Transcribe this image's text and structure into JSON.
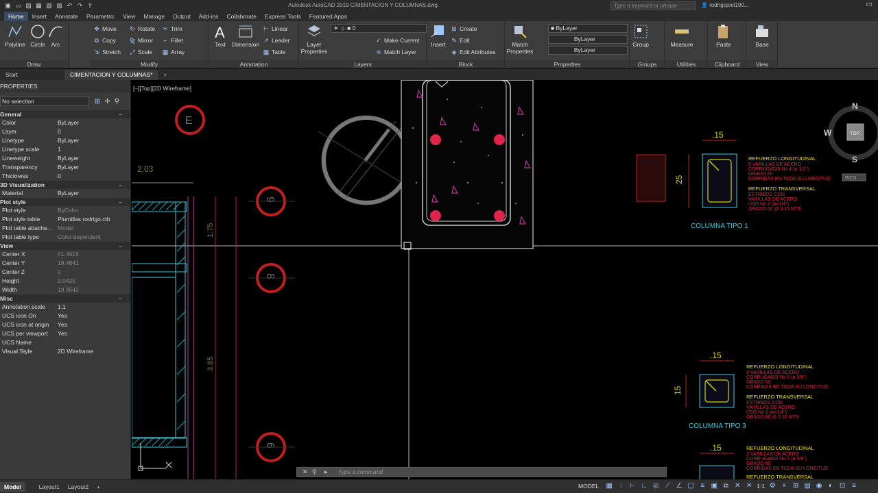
{
  "app": {
    "title": "Autodesk AutoCAD 2019    CIMENTACION Y COLUMNAS.dwg",
    "search_placeholder": "Type a keyword or phrase",
    "user": "rodrigojoel190..."
  },
  "ribbon_tabs": [
    "Home",
    "Insert",
    "Annotate",
    "Parametric",
    "View",
    "Manage",
    "Output",
    "Add-ins",
    "Collaborate",
    "Express Tools",
    "Featured Apps"
  ],
  "ribbon": {
    "draw": {
      "title": "Draw",
      "polyline": "Polyline",
      "circle": "Circle",
      "arc": "Arc"
    },
    "modify": {
      "title": "Modify",
      "move": "Move",
      "rotate": "Rotate",
      "trim": "Trim",
      "copy": "Copy",
      "mirror": "Mirror",
      "fillet": "Fillet",
      "stretch": "Stretch",
      "scale": "Scale",
      "array": "Array"
    },
    "annotation": {
      "title": "Annotation",
      "text": "Text",
      "dimension": "Dimension",
      "linear": "Linear",
      "leader": "Leader",
      "table": "Table"
    },
    "layers": {
      "title": "Layers",
      "layer_properties": "Layer Properties",
      "layer_value": "0",
      "make_current": "Make Current",
      "match_layer": "Match Layer"
    },
    "block": {
      "title": "Block",
      "insert": "Insert",
      "create": "Create",
      "edit": "Edit",
      "edit_attributes": "Edit Attributes"
    },
    "properties": {
      "title": "Properties",
      "match_properties": "Match Properties",
      "color": "ByLayer",
      "linetype": "ByLayer",
      "lineweight": "ByLayer"
    },
    "groups": {
      "title": "Groups",
      "group": "Group"
    },
    "utilities": {
      "title": "Utilities",
      "measure": "Measure"
    },
    "clipboard": {
      "title": "Clipboard",
      "paste": "Paste"
    },
    "view": {
      "title": "View",
      "base": "Base"
    }
  },
  "doc_tabs": {
    "start": "Start",
    "active": "CIMENTACION Y COLUMNAS*"
  },
  "properties_palette": {
    "title": "PROPERTIES",
    "selection": "No selection",
    "sections": [
      {
        "name": "General",
        "rows": [
          [
            "Color",
            "ByLayer"
          ],
          [
            "Layer",
            "0"
          ],
          [
            "Linetype",
            "ByLayer"
          ],
          [
            "Linetype scale",
            "1"
          ],
          [
            "Lineweight",
            "ByLayer"
          ],
          [
            "Transparency",
            "ByLayer"
          ],
          [
            "Thickness",
            "0"
          ]
        ]
      },
      {
        "name": "3D Visualization",
        "rows": [
          [
            "Material",
            "ByLayer"
          ]
        ]
      },
      {
        "name": "Plot style",
        "rows": [
          [
            "Plot style",
            "ByColor"
          ],
          [
            "Plot style table",
            "Plumillas rodrigo.ctb"
          ],
          [
            "Plot table attache...",
            "Model"
          ],
          [
            "Plot table type",
            "Color dependent"
          ]
        ]
      },
      {
        "name": "View",
        "rows": [
          [
            "Center X",
            "41.4915"
          ],
          [
            "Center Y",
            "19.4841"
          ],
          [
            "Center Z",
            "0"
          ],
          [
            "Height",
            "9.0425"
          ],
          [
            "Width",
            "19.9542"
          ]
        ]
      },
      {
        "name": "Misc",
        "rows": [
          [
            "Annotation scale",
            "1:1"
          ],
          [
            "UCS icon On",
            "Yes"
          ],
          [
            "UCS icon at origin",
            "Yes"
          ],
          [
            "UCS per viewport",
            "Yes"
          ],
          [
            "UCS Name",
            ""
          ],
          [
            "Visual Style",
            "2D Wireframe"
          ]
        ]
      }
    ]
  },
  "viewport": {
    "label": "[–][Top][2D Wireframe]",
    "viewcube": {
      "north": "N",
      "south": "S",
      "west": "W",
      "top": "TOP",
      "wcs": "WCS"
    },
    "grid_bubbles": [
      "E",
      "9",
      "8",
      "6"
    ],
    "dims": {
      "d1": "2.03",
      "d2": "1.75",
      "d3": "3.85"
    }
  },
  "details": {
    "tipo1": {
      "title": "COLUMNA  TIPO  1",
      "width_dim": ".15",
      "height_dim": "25",
      "long_title": "REFUERZO  LONGITUDINAL",
      "long_lines": [
        "6  VARILLAS  DE  ACERO",
        "CORRUGADO  No  4  (ø 1/2\")",
        "GRADO  60",
        "CORRIDAS  EN  TODA  SU  LONGITUD"
      ],
      "trans_title": "REFUERZO  TRANSVERSAL",
      "trans_lines": [
        "ESTRIBOS  CON",
        "VARILLAS  DE  ACERO",
        "USO  No  2  (ø=1/4\")",
        "GRADO  60  @  0.15  MTS"
      ]
    },
    "tipo3": {
      "title": "COLUMNA  TIPO  3",
      "width_dim": ".15",
      "height_dim": "15",
      "long_title": "REFUERZO  LONGITUDINAL",
      "long_lines": [
        "4  VARILLAS  DE  ACERO",
        "CORRUGADO  No  3  (ø 3/8\")",
        "GRADO  60",
        "CORRIDAS  EN  TODA  SU  LONGITUD"
      ],
      "trans_title": "REFUERZO  TRANSVERSAL",
      "trans_lines": [
        "ESTRIBOS  CON",
        "VARILLAS  DE  ACERO",
        "USO  No  2  (ø=1/4\")",
        "GRADO  60  @  0.15  MTS"
      ]
    },
    "tipo4": {
      "width_dim": ".15",
      "long_title": "REFUERZO  LONGITUDINAL",
      "long_lines": [
        "2  VARILLAS  DE  ACERO",
        "CORRUGADO  No  3  (ø 3/8\")",
        "GRADO  60",
        "CORRIDAS  EN  TODA  SU  LONGITUD"
      ],
      "trans_title": "REFUERZO  TRANSVERSAL"
    }
  },
  "command_line": {
    "placeholder": "Type a command"
  },
  "statusbar": {
    "model_tab": "Model",
    "layout1": "Layout1",
    "layout2": "Layout2",
    "model_label": "MODEL",
    "scale": "1:1"
  },
  "colors": {
    "accent": "#3a4a63",
    "rebar": "#e0244a",
    "yellow_text": "#f4e300",
    "red_text": "#e0244a",
    "cyan": "#3ec8d8"
  }
}
